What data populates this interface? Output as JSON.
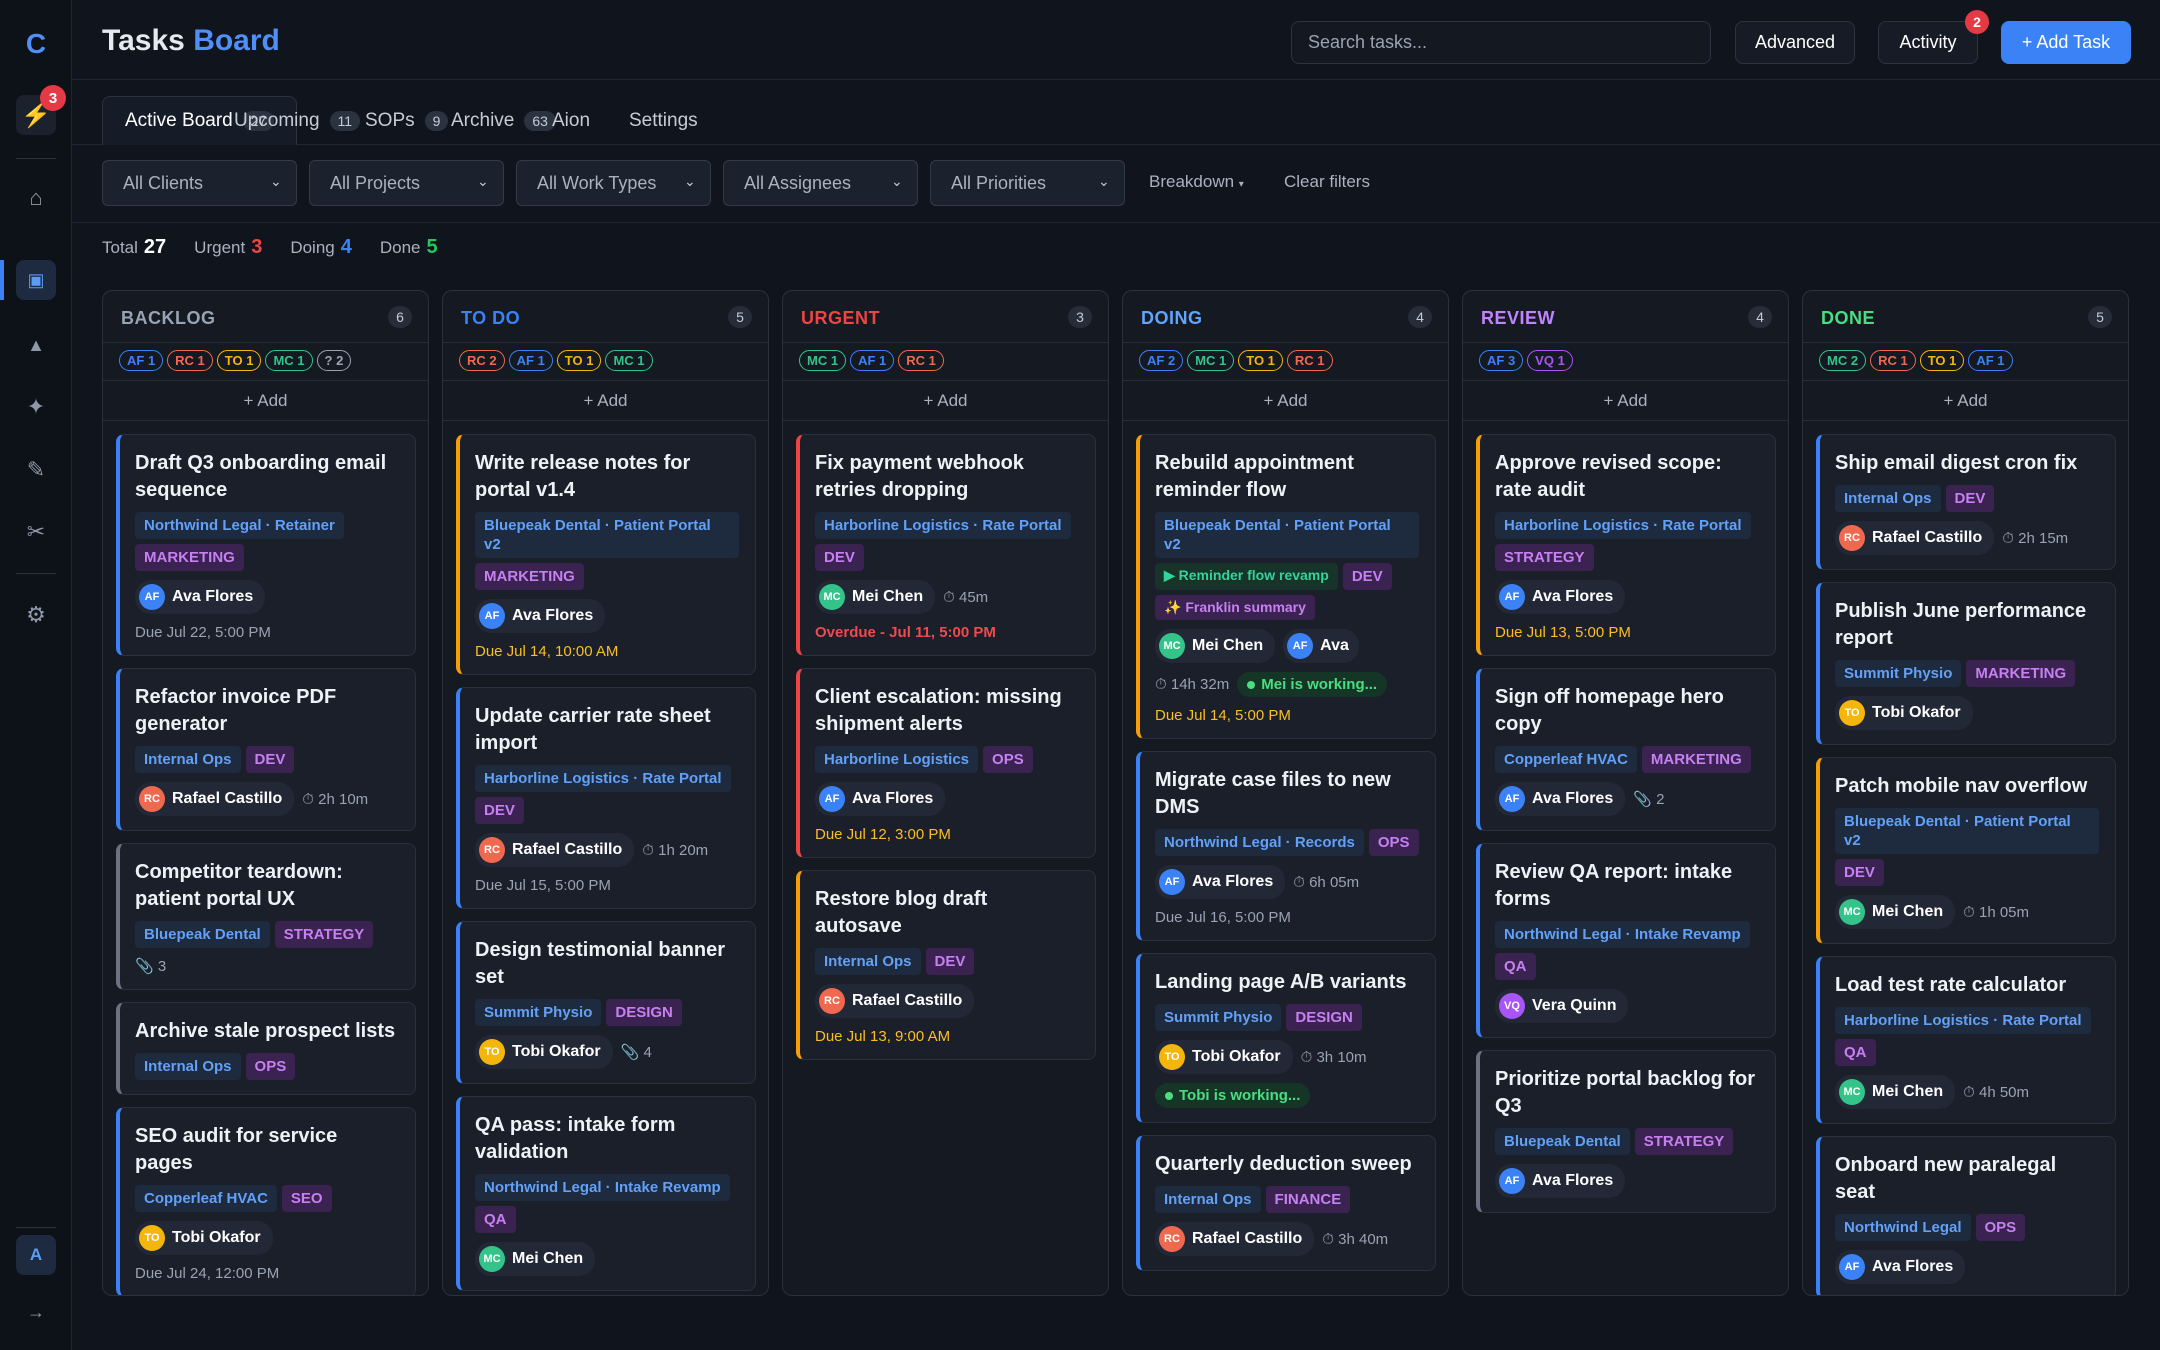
{
  "app": {
    "logo": "C",
    "title_a": "Tasks",
    "title_b": "Board",
    "rail_badge": "3",
    "rail_user": "A"
  },
  "search": {
    "placeholder": "Search tasks..."
  },
  "header": {
    "advanced": "Advanced",
    "activity": "Activity",
    "activity_badge": "2",
    "add_task": "+ Add Task"
  },
  "tabs": [
    {
      "label": "Active Board",
      "count": "27"
    },
    {
      "label": "Upcoming",
      "count": "11"
    },
    {
      "label": "SOPs",
      "count": "9"
    },
    {
      "label": "Archive",
      "count": "63"
    },
    {
      "label": "Aion",
      "count": ""
    },
    {
      "label": "Settings",
      "count": ""
    }
  ],
  "filters": {
    "clients": "All Clients",
    "projects": "All Projects",
    "work_types": "All Work Types",
    "assignees": "All Assignees",
    "priorities": "All Priorities",
    "breakdown": "Breakdown",
    "clear": "Clear filters"
  },
  "stats": [
    {
      "label": "Total",
      "value": "27",
      "color": "#ffffff"
    },
    {
      "label": "Urgent",
      "value": "3",
      "color": "#ef4444"
    },
    {
      "label": "Doing",
      "value": "4",
      "color": "#3b82f6"
    },
    {
      "label": "Done",
      "value": "5",
      "color": "#22c55e"
    }
  ],
  "add_label": "+ Add",
  "colors": {
    "AF": "#3b82f6",
    "RC": "#f0694f",
    "TO": "#f5b60b",
    "MC": "#34c48a",
    "VQ": "#a855f7",
    "?": "#9aa3b2"
  },
  "columns": [
    {
      "title": "BACKLOG",
      "count": "6",
      "color": "#9aa3b2",
      "chips": [
        {
          "code": "AF",
          "n": "1"
        },
        {
          "code": "RC",
          "n": "1"
        },
        {
          "code": "TO",
          "n": "1"
        },
        {
          "code": "MC",
          "n": "1"
        },
        {
          "code": "?",
          "n": "2"
        }
      ],
      "cards": [
        {
          "title": "Draft Q3 onboarding email sequence",
          "accent": "bl",
          "project": "Northwind Legal · Retainer",
          "tags": [
            "MARKETING"
          ],
          "assignee": {
            "code": "AF",
            "name": "Ava Flores"
          },
          "due": "Due Jul 22, 5:00 PM",
          "due_style": ""
        },
        {
          "title": "Refactor invoice PDF generator",
          "accent": "bl",
          "project": "Internal Ops",
          "tags": [
            "DEV"
          ],
          "assignee": {
            "code": "RC",
            "name": "Rafael Castillo"
          },
          "extra": "⏱ 2h 10m"
        },
        {
          "title": "Competitor teardown: patient portal UX",
          "accent": "gr",
          "project": "Bluepeak Dental",
          "tags": [
            "STRATEGY"
          ],
          "extra": "📎 3"
        },
        {
          "title": "Archive stale prospect lists",
          "accent": "gr",
          "project": "Internal Ops",
          "tags": [
            "OPS"
          ]
        },
        {
          "title": "SEO audit for service pages",
          "accent": "bl",
          "project": "Copperleaf HVAC",
          "tags": [
            "SEO"
          ],
          "assignee": {
            "code": "TO",
            "name": "Tobi Okafor"
          },
          "due": "Due Jul 24, 12:00 PM",
          "due_style": ""
        }
      ]
    },
    {
      "title": "TO DO",
      "count": "5",
      "color": "#3b82f6",
      "chips": [
        {
          "code": "RC",
          "n": "2"
        },
        {
          "code": "AF",
          "n": "1"
        },
        {
          "code": "TO",
          "n": "1"
        },
        {
          "code": "MC",
          "n": "1"
        }
      ],
      "cards": [
        {
          "title": "Write release notes for portal v1.4",
          "accent": "or",
          "project": "Bluepeak Dental · Patient Portal v2",
          "tags": [
            "MARKETING"
          ],
          "assignee": {
            "code": "AF",
            "name": "Ava Flores"
          },
          "due": "Due Jul 14, 10:00 AM",
          "due_style": "w"
        },
        {
          "title": "Update carrier rate sheet import",
          "accent": "bl",
          "project": "Harborline Logistics · Rate Portal",
          "tags": [
            "DEV"
          ],
          "assignee": {
            "code": "RC",
            "name": "Rafael Castillo"
          },
          "extra": "⏱ 1h 20m",
          "due": "Due Jul 15, 5:00 PM",
          "due_style": ""
        },
        {
          "title": "Design testimonial banner set",
          "accent": "bl",
          "project": "Summit Physio",
          "tags": [
            "DESIGN"
          ],
          "assignee": {
            "code": "TO",
            "name": "Tobi Okafor"
          },
          "extra": "📎 4"
        },
        {
          "title": "QA pass: intake form validation",
          "accent": "bl",
          "project": "Northwind Legal · Intake Revamp",
          "tags": [
            "QA"
          ],
          "assignee": {
            "code": "MC",
            "name": "Mei Chen"
          }
        }
      ]
    },
    {
      "title": "URGENT",
      "count": "3",
      "color": "#ef4444",
      "chips": [
        {
          "code": "MC",
          "n": "1"
        },
        {
          "code": "AF",
          "n": "1"
        },
        {
          "code": "RC",
          "n": "1"
        }
      ],
      "cards": [
        {
          "title": "Fix payment webhook retries dropping",
          "accent": "rd",
          "project": "Harborline Logistics · Rate Portal",
          "tags": [
            "DEV"
          ],
          "assignee": {
            "code": "MC",
            "name": "Mei Chen"
          },
          "extra": "⏱ 45m",
          "due": "Overdue - Jul 11, 5:00 PM",
          "due_style": "r"
        },
        {
          "title": "Client escalation: missing shipment alerts",
          "accent": "rd",
          "project": "Harborline Logistics",
          "tags": [
            "OPS"
          ],
          "assignee": {
            "code": "AF",
            "name": "Ava Flores"
          },
          "due": "Due Jul 12, 3:00 PM",
          "due_style": "w"
        },
        {
          "title": "Restore blog draft autosave",
          "accent": "or",
          "project": "Internal Ops",
          "tags": [
            "DEV"
          ],
          "assignee": {
            "code": "RC",
            "name": "Rafael Castillo"
          },
          "due": "Due Jul 13, 9:00 AM",
          "due_style": "w"
        }
      ]
    },
    {
      "title": "DOING",
      "count": "4",
      "color": "#60a5fa",
      "chips": [
        {
          "code": "AF",
          "n": "2"
        },
        {
          "code": "MC",
          "n": "1"
        },
        {
          "code": "TO",
          "n": "1"
        },
        {
          "code": "RC",
          "n": "1"
        }
      ],
      "cards": [
        {
          "title": "Rebuild appointment reminder flow",
          "accent": "or",
          "project": "Bluepeak Dental · Patient Portal v2",
          "milestone": "▶ Reminder flow revamp",
          "tags": [
            "DEV"
          ],
          "summary": "✨ Franklin summary",
          "assignee": {
            "code": "MC",
            "name": "Mei Chen"
          },
          "assignee2": {
            "code": "AF",
            "name": "Ava"
          },
          "timer": "⏱ 14h 32m",
          "working": "Mei is working...",
          "due": "Due Jul 14, 5:00 PM",
          "due_style": "w"
        },
        {
          "title": "Migrate case files to new DMS",
          "accent": "bl",
          "project": "Northwind Legal · Records",
          "tags": [
            "OPS"
          ],
          "assignee": {
            "code": "AF",
            "name": "Ava Flores"
          },
          "extra": "⏱ 6h 05m",
          "due": "Due Jul 16, 5:00 PM",
          "due_style": ""
        },
        {
          "title": "Landing page A/B variants",
          "accent": "bl",
          "project": "Summit Physio",
          "tags": [
            "DESIGN"
          ],
          "assignee": {
            "code": "TO",
            "name": "Tobi Okafor"
          },
          "extra": "⏱ 3h 10m",
          "working": "Tobi is working..."
        },
        {
          "title": "Quarterly deduction sweep",
          "accent": "bl",
          "project": "Internal Ops",
          "tags": [
            "FINANCE"
          ],
          "assignee": {
            "code": "RC",
            "name": "Rafael Castillo"
          },
          "extra": "⏱ 3h 40m"
        }
      ]
    },
    {
      "title": "REVIEW",
      "count": "4",
      "color": "#c084fc",
      "chips": [
        {
          "code": "AF",
          "n": "3"
        },
        {
          "code": "VQ",
          "n": "1"
        }
      ],
      "cards": [
        {
          "title": "Approve revised scope: rate audit",
          "accent": "or",
          "project": "Harborline Logistics · Rate Portal",
          "tags": [
            "STRATEGY"
          ],
          "assignee": {
            "code": "AF",
            "name": "Ava Flores"
          },
          "due": "Due Jul 13, 5:00 PM",
          "due_style": "w"
        },
        {
          "title": "Sign off homepage hero copy",
          "accent": "bl",
          "project": "Copperleaf HVAC",
          "tags": [
            "MARKETING"
          ],
          "assignee": {
            "code": "AF",
            "name": "Ava Flores"
          },
          "extra": "📎 2"
        },
        {
          "title": "Review QA report: intake forms",
          "accent": "bl",
          "project": "Northwind Legal · Intake Revamp",
          "tags": [
            "QA"
          ],
          "assignee": {
            "code": "VQ",
            "name": "Vera Quinn"
          }
        },
        {
          "title": "Prioritize portal backlog for Q3",
          "accent": "gr",
          "project": "Bluepeak Dental",
          "tags": [
            "STRATEGY"
          ],
          "assignee": {
            "code": "AF",
            "name": "Ava Flores"
          }
        }
      ]
    },
    {
      "title": "DONE",
      "count": "5",
      "color": "#4ade80",
      "chips": [
        {
          "code": "MC",
          "n": "2"
        },
        {
          "code": "RC",
          "n": "1"
        },
        {
          "code": "TO",
          "n": "1"
        },
        {
          "code": "AF",
          "n": "1"
        }
      ],
      "cards": [
        {
          "title": "Ship email digest cron fix",
          "accent": "bl",
          "project": "Internal Ops",
          "tags": [
            "DEV"
          ],
          "assignee": {
            "code": "RC",
            "name": "Rafael Castillo"
          },
          "extra": "⏱ 2h 15m"
        },
        {
          "title": "Publish June performance report",
          "accent": "bl",
          "project": "Summit Physio",
          "tags": [
            "MARKETING"
          ],
          "assignee": {
            "code": "TO",
            "name": "Tobi Okafor"
          }
        },
        {
          "title": "Patch mobile nav overflow",
          "accent": "or",
          "project": "Bluepeak Dental · Patient Portal v2",
          "tags": [
            "DEV"
          ],
          "assignee": {
            "code": "MC",
            "name": "Mei Chen"
          },
          "extra": "⏱ 1h 05m"
        },
        {
          "title": "Load test rate calculator",
          "accent": "bl",
          "project": "Harborline Logistics · Rate Portal",
          "tags": [
            "QA"
          ],
          "assignee": {
            "code": "MC",
            "name": "Mei Chen"
          },
          "extra": "⏱ 4h 50m"
        },
        {
          "title": "Onboard new paralegal seat",
          "accent": "bl",
          "project": "Northwind Legal",
          "tags": [
            "OPS"
          ],
          "assignee": {
            "code": "AF",
            "name": "Ava Flores"
          }
        }
      ]
    }
  ]
}
